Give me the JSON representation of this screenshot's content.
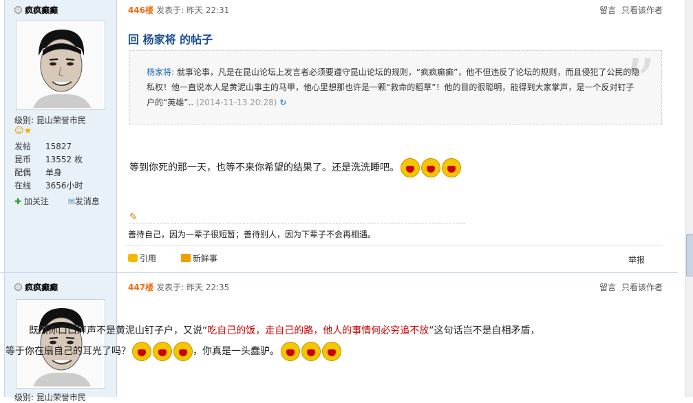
{
  "posts": [
    {
      "author": "疯疯癫癫",
      "level_label": "级别:",
      "level": "昆山荣誉市民",
      "stats": [
        {
          "k": "发帖",
          "v": "15827"
        },
        {
          "k": "昆币",
          "v": "13552 枚"
        },
        {
          "k": "配偶",
          "v": "单身"
        },
        {
          "k": "在线",
          "v": "3656小时"
        }
      ],
      "follow": "加关注",
      "message": "发消息",
      "floor": "446楼",
      "time": "发表于: 昨天 22:31",
      "reply": "留言",
      "only_author": "只看该作者",
      "title": "回 杨家将 的帖子",
      "quote_author": "杨家将:",
      "quote_text": "就事论事，凡是在昆山论坛上发言者必须要遵守昆山论坛的规则，“疯疯癫癫”，他不但违反了论坛的规则，而且侵犯了公民的隐私权！他一直说本人是黄泥山事主的马甲，他心里想那也许是一颗“救命的稻草”！他的目的很聪明，能得到大家掌声，是一个反对钉子户的“英雄”..",
      "quote_time": "(2014-11-13 20:28)",
      "body": "等到你死的那一天，也等不来你希望的结果了。还是洗洗睡吧。",
      "signature": "善待自己，因为一辈子很短暂；善待别人，因为下辈子不会再相遇。",
      "cite": "引用",
      "fresh": "新鲜事",
      "report": "举报"
    },
    {
      "author": "疯疯癫癫",
      "level_label": "级别:",
      "level": "昆山荣誉市民",
      "floor": "447楼",
      "time": "发表于: 昨天 22:35",
      "reply": "留言",
      "only_author": "只看该作者",
      "body_a": "既然你口口声声不是黄泥山钉子户，又说“",
      "body_red": "吃自己的饭，走自己的路，他人的事情何必穷追不放",
      "body_b": "”这句话岂不是自相矛盾，等于你在扇自己的耳光了吗？",
      "body_c": "，你真是一头蠢驴。"
    }
  ]
}
